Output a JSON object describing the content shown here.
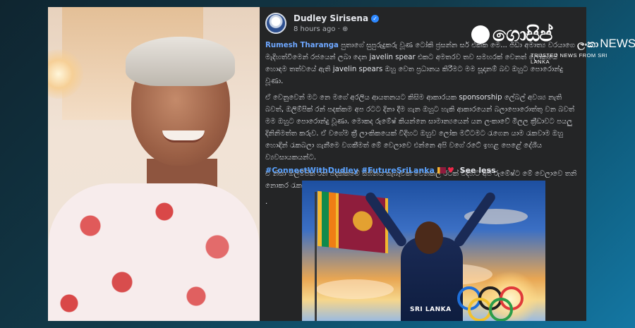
{
  "post": {
    "author": "Dudley Sirisena",
    "time": "8 hours ago",
    "privacy_icon": "globe-icon",
    "mention": "Rumesh Tharanga",
    "paragraph1": "පුතාගේ සුපුරුදුකරු වූණ ටෝකි ජ්‍රසන්න සර් එක්ක මෙ... ජිඩා අමාත්‍ය වරයාගෙ මැදිහත්වීමෙන් රජයෙන් ලබා දෙන javelin spear එකට අමතරව තව සමහරක් වෙනත් ලෝකයේ හොඳම තත්වයේ ඇති javelin spears ඔහු වෙත ප්‍රධානය කිරීමට මම සූදානම් බව ඔහුට පොරොන්දු වූණා.",
    "paragraph2": "ඒ වෙනුවෙන් මට නෙ මගේ අරලිය ආයතනයට කිසිම ආකාරයක sponsorship ලේබල් අවශ්‍ය නැති බවත්, ඔලිම්පික් රන් පදක්කම අප රටට දිනා දීම ගැන ඔහුට හැකි ආකාරයෙන් බලාපොරොත්තු වන බවත් මම ඔහුට පොරොන්දු වූණා. මොකද රුමේෂ් කියන්නෙ සාමාන්‍යයෙන් යන ලංකාවේ මිලල ක්‍රීඩාවට පයලු දිනිනිමත්ත කරුව. ඒ වගේම ක්‍රී ලාංකිකයෙක් විදිහට ඔහුව ලෝක මට්ටමට රැගෙන යාම රැකවාම ඔහු හොඳින් රැකබලා ගැනීමෙ වගකීමත් මේ වෙලාවෙ එන්නෙ අපි වගේ රටේ ඉහළ පෙළේ දේශීය ව්‍යවසායකයන්ට.",
    "paragraph3": "ඒ නිසා ඔලිම්පික් රන් පදක්කමේ සිහිනය සැබෑවක් වෙනකල් රටක් විදිහට අපි රුමේෂ්ට මේ වෙලාවෙ තනි නොකර රැකගන්නම ඕන.!",
    "dot": ".",
    "hashtag1": "#ConnectWithDudley",
    "hashtag2": "#FutureSriLanka",
    "see_less": "See less",
    "jersey_text": "SRI LANKA"
  },
  "watermark": {
    "logo_text": "ගොසිප්",
    "sub_text": "ලංකා",
    "news": "NEWS",
    "tagline": "TRUSTED NEWS FROM SRI LANKA"
  },
  "colors": {
    "post_bg": "#242526",
    "link": "#6ea7ff",
    "hashtag": "#5aa2ff",
    "verified": "#2d88ff"
  }
}
